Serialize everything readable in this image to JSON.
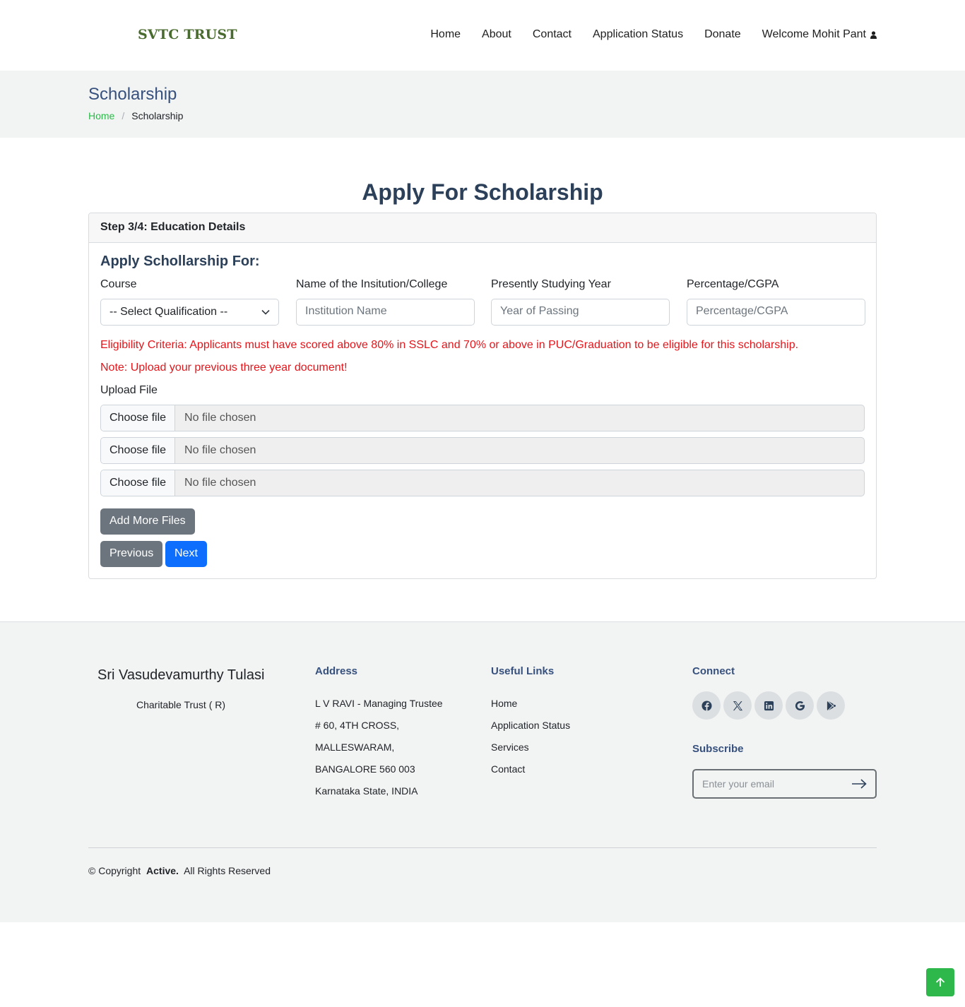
{
  "header": {
    "logo": "SVTC TRUST",
    "nav": [
      "Home",
      "About",
      "Contact",
      "Application Status",
      "Donate",
      "Welcome Mohit Pant"
    ]
  },
  "titlebar": {
    "title": "Scholarship",
    "breadcrumb_home": "Home",
    "breadcrumb_sep": "/",
    "breadcrumb_current": "Scholarship"
  },
  "main": {
    "title": "Apply For Scholarship",
    "step": "Step 3/4: Education Details",
    "section_title": "Apply Schollarship For:",
    "fields": {
      "course_label": "Course",
      "course_value": "-- Select Qualification --",
      "institution_label": "Name of the Insitution/College",
      "institution_placeholder": "Institution Name",
      "year_label": "Presently Studying Year",
      "year_placeholder": "Year of Passing",
      "percentage_label": "Percentage/CGPA",
      "percentage_placeholder": "Percentage/CGPA"
    },
    "eligibility": "Eligibility Criteria: Applicants must have scored above 80% in SSLC and 70% or above in PUC/Graduation to be eligible for this scholarship.",
    "note": "Note: Upload your previous three year document!",
    "upload_label": "Upload File",
    "files": [
      {
        "button": "Choose file",
        "status": "No file chosen"
      },
      {
        "button": "Choose file",
        "status": "No file chosen"
      },
      {
        "button": "Choose file",
        "status": "No file chosen"
      }
    ],
    "add_more": "Add More Files",
    "previous": "Previous",
    "next": "Next"
  },
  "footer": {
    "brand": "Sri Vasudevamurthy Tulasi",
    "brand_sub": "Charitable Trust ( R)",
    "address_heading": "Address",
    "address_lines": [
      "L V RAVI - Managing Trustee",
      "# 60, 4TH CROSS,",
      "MALLESWARAM,",
      "BANGALORE 560 003",
      "Karnataka State, INDIA"
    ],
    "links_heading": "Useful Links",
    "links": [
      "Home",
      "Application Status",
      "Services",
      "Contact"
    ],
    "connect_heading": "Connect",
    "social_icons": [
      "facebook-icon",
      "x-twitter-icon",
      "linkedin-icon",
      "google-icon",
      "google-play-icon"
    ],
    "subscribe_heading": "Subscribe",
    "subscribe_placeholder": "Enter your email",
    "copyright_prefix": "© Copyright",
    "copyright_brand": "Active.",
    "copyright_suffix": "All Rights Reserved"
  },
  "colors": {
    "accent_green": "#2eb84b",
    "heading_navy": "#2c4159",
    "primary_blue": "#0d6efd",
    "error_red": "#e3161b"
  }
}
